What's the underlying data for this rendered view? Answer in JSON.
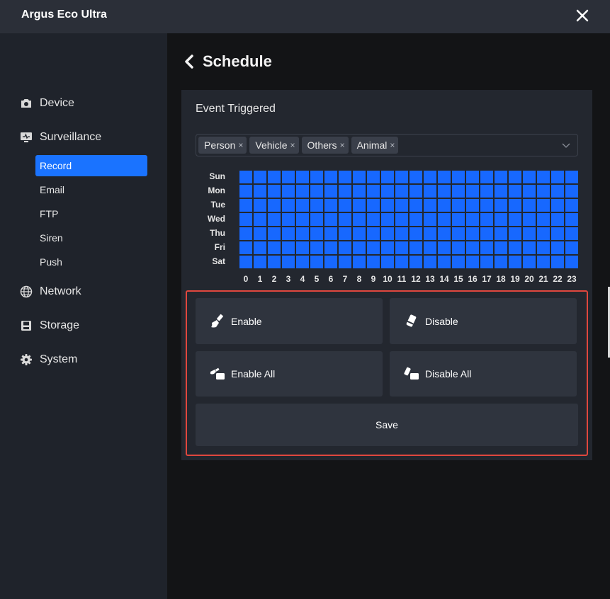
{
  "window": {
    "title": "Argus Eco Ultra"
  },
  "sidebar": {
    "items": [
      {
        "id": "device",
        "label": "Device",
        "icon": "camera-icon"
      },
      {
        "id": "surveillance",
        "label": "Surveillance",
        "icon": "monitor-icon"
      },
      {
        "id": "network",
        "label": "Network",
        "icon": "globe-icon"
      },
      {
        "id": "storage",
        "label": "Storage",
        "icon": "disk-icon"
      },
      {
        "id": "system",
        "label": "System",
        "icon": "gear-icon"
      }
    ],
    "surveillance_sub": [
      {
        "id": "record",
        "label": "Record",
        "active": true
      },
      {
        "id": "email",
        "label": "Email",
        "active": false
      },
      {
        "id": "ftp",
        "label": "FTP",
        "active": false
      },
      {
        "id": "siren",
        "label": "Siren",
        "active": false
      },
      {
        "id": "push",
        "label": "Push",
        "active": false
      }
    ]
  },
  "page": {
    "title": "Schedule"
  },
  "card": {
    "title": "Event Triggered",
    "tags": [
      "Person",
      "Vehicle",
      "Others",
      "Animal"
    ],
    "tag_remove_glyph": "×"
  },
  "schedule": {
    "days": [
      "Sun",
      "Mon",
      "Tue",
      "Wed",
      "Thu",
      "Fri",
      "Sat"
    ],
    "hours": [
      "0",
      "1",
      "2",
      "3",
      "4",
      "5",
      "6",
      "7",
      "8",
      "9",
      "10",
      "11",
      "12",
      "13",
      "14",
      "15",
      "16",
      "17",
      "18",
      "19",
      "20",
      "21",
      "22",
      "23"
    ],
    "all_enabled": true,
    "enabled_color": "#1768ff"
  },
  "actions": {
    "enable": "Enable",
    "disable": "Disable",
    "enable_all": "Enable All",
    "disable_all": "Disable All",
    "save": "Save"
  },
  "colors": {
    "accent": "#1a73ff",
    "highlight": "#e0473e"
  }
}
